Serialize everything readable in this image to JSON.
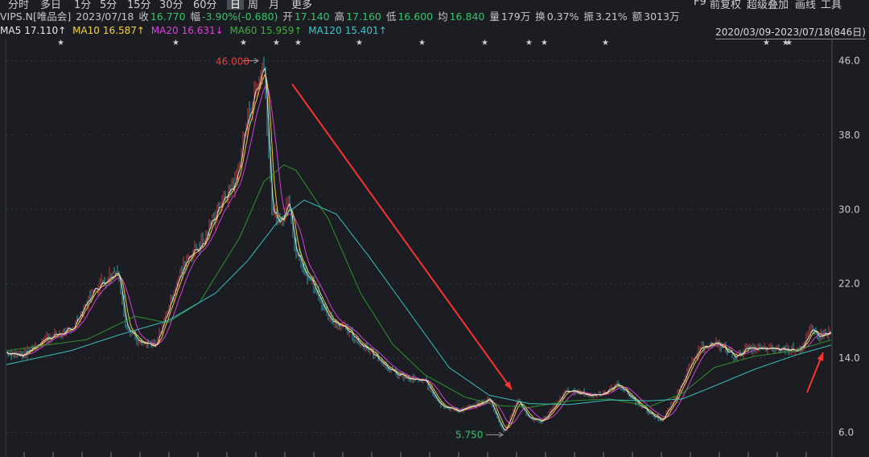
{
  "toolbar": {
    "tabs": [
      "分时",
      "多日",
      "1分",
      "5分",
      "15分",
      "30分",
      "60分",
      "日",
      "周",
      "月",
      "更多"
    ],
    "right": [
      "F9",
      "前复权",
      "超级叠加",
      "画线",
      "工具"
    ],
    "active": "日"
  },
  "quote": {
    "symbol": "VIPS.N[唯品会]",
    "date": "2023/07/18",
    "close_label": "收",
    "close": "16.770",
    "change_label": "幅",
    "change": "-3.90%(-0.680)",
    "open_label": "开",
    "open": "17.140",
    "high_label": "高",
    "high": "17.160",
    "low_label": "低",
    "low": "16.600",
    "avg_label": "均",
    "avg": "16.840",
    "volume_label": "量",
    "volume": "179万",
    "turnover_label": "换",
    "turnover": "0.37%",
    "amplitude_label": "振",
    "amplitude": "3.21%",
    "amount_label": "额",
    "amount": "3013万"
  },
  "ma": {
    "ma5": {
      "label": "MA5",
      "value": "17.110↑"
    },
    "ma10": {
      "label": "MA10",
      "value": "16.587↑"
    },
    "ma20": {
      "label": "MA20",
      "value": "16.631↓"
    },
    "ma60": {
      "label": "MA60",
      "value": "15.959↑"
    },
    "ma120": {
      "label": "MA120",
      "value": "15.401↑"
    }
  },
  "range_label": "2020/03/09-2023/07/18(846日)",
  "annotations": {
    "high": "46.000",
    "low": "5.750"
  },
  "colors": {
    "bg": "#1b1d22",
    "grid": "#343640",
    "up": "#e8413e",
    "down": "#27c2c2",
    "ma5": "#e8e8e8",
    "ma10": "#f5d23c",
    "ma20": "#e040e0",
    "ma60": "#2f9a2f",
    "ma120": "#3cc7c7",
    "arrow": "#ff3030",
    "axis_text": "#c8c8c8"
  },
  "chart_data": {
    "type": "line",
    "title": "",
    "ylim": [
      5.0,
      47.0
    ],
    "y_ticks": [
      "46.0",
      "38.0",
      "30.0",
      "22.0",
      "14.0",
      "6.0"
    ],
    "y_tick_values": [
      46.0,
      38.0,
      30.0,
      22.0,
      14.0,
      6.0
    ],
    "x_range": [
      "2020/03/09",
      "2023/07/18"
    ],
    "bars": 846,
    "series": [
      {
        "key": "price",
        "values": [
          [
            0,
            14.6
          ],
          [
            20,
            14.3
          ],
          [
            50,
            16.2
          ],
          [
            80,
            17.0
          ],
          [
            110,
            21.5
          ],
          [
            138,
            23.5
          ],
          [
            148,
            17.8
          ],
          [
            165,
            15.6
          ],
          [
            185,
            15.2
          ],
          [
            205,
            20.5
          ],
          [
            225,
            25.0
          ],
          [
            245,
            26.5
          ],
          [
            262,
            30.0
          ],
          [
            285,
            33.0
          ],
          [
            300,
            40.0
          ],
          [
            320,
            46.0
          ],
          [
            330,
            30.0
          ],
          [
            340,
            28.2
          ],
          [
            350,
            31.0
          ],
          [
            360,
            25.5
          ],
          [
            380,
            22.0
          ],
          [
            400,
            18.5
          ],
          [
            420,
            17.2
          ],
          [
            440,
            15.6
          ],
          [
            460,
            14.2
          ],
          [
            480,
            12.5
          ],
          [
            500,
            11.8
          ],
          [
            520,
            11.5
          ],
          [
            540,
            9.0
          ],
          [
            560,
            8.3
          ],
          [
            580,
            8.8
          ],
          [
            600,
            9.6
          ],
          [
            618,
            6.0
          ],
          [
            635,
            9.5
          ],
          [
            650,
            7.5
          ],
          [
            665,
            7.2
          ],
          [
            680,
            8.6
          ],
          [
            695,
            10.5
          ],
          [
            712,
            10.3
          ],
          [
            725,
            10.0
          ],
          [
            745,
            10.3
          ],
          [
            760,
            11.2
          ],
          [
            780,
            9.5
          ],
          [
            800,
            8.0
          ],
          [
            815,
            7.3
          ],
          [
            830,
            9.5
          ],
          [
            848,
            13.0
          ],
          [
            865,
            15.3
          ],
          [
            885,
            15.5
          ],
          [
            905,
            14.2
          ],
          [
            920,
            15.0
          ],
          [
            940,
            15.0
          ],
          [
            960,
            15.0
          ],
          [
            980,
            15.0
          ],
          [
            990,
            15.2
          ],
          [
            1000,
            17.0
          ],
          [
            1010,
            16.5
          ],
          [
            1025,
            16.77
          ]
        ]
      },
      {
        "key": "ma60",
        "values": [
          [
            0,
            14.8
          ],
          [
            100,
            16.0
          ],
          [
            160,
            18.5
          ],
          [
            200,
            17.8
          ],
          [
            240,
            20.0
          ],
          [
            290,
            27.0
          ],
          [
            320,
            33.0
          ],
          [
            345,
            34.8
          ],
          [
            360,
            34.2
          ],
          [
            400,
            29.0
          ],
          [
            440,
            21.0
          ],
          [
            480,
            15.5
          ],
          [
            520,
            12.2
          ],
          [
            570,
            9.8
          ],
          [
            610,
            8.9
          ],
          [
            650,
            8.7
          ],
          [
            700,
            9.4
          ],
          [
            750,
            9.6
          ],
          [
            800,
            8.8
          ],
          [
            840,
            10.2
          ],
          [
            880,
            13.0
          ],
          [
            930,
            14.2
          ],
          [
            980,
            14.8
          ],
          [
            1025,
            15.96
          ]
        ]
      },
      {
        "key": "ma120",
        "values": [
          [
            0,
            13.3
          ],
          [
            80,
            14.8
          ],
          [
            140,
            16.5
          ],
          [
            200,
            18.0
          ],
          [
            260,
            21.0
          ],
          [
            300,
            24.5
          ],
          [
            340,
            29.0
          ],
          [
            370,
            31.0
          ],
          [
            410,
            29.5
          ],
          [
            450,
            25.0
          ],
          [
            500,
            19.0
          ],
          [
            550,
            13.0
          ],
          [
            600,
            10.0
          ],
          [
            650,
            9.1
          ],
          [
            700,
            9.0
          ],
          [
            750,
            9.5
          ],
          [
            800,
            9.4
          ],
          [
            840,
            9.6
          ],
          [
            880,
            11.0
          ],
          [
            930,
            12.8
          ],
          [
            980,
            14.3
          ],
          [
            1025,
            15.4
          ]
        ]
      }
    ],
    "markers": [
      "46.000",
      "5.750"
    ],
    "arrows": [
      {
        "from": [
          355,
          43.5
        ],
        "to": [
          628,
          10.6
        ]
      },
      {
        "from": [
          995,
          10.3
        ],
        "to": [
          1015,
          14.6
        ]
      }
    ]
  }
}
